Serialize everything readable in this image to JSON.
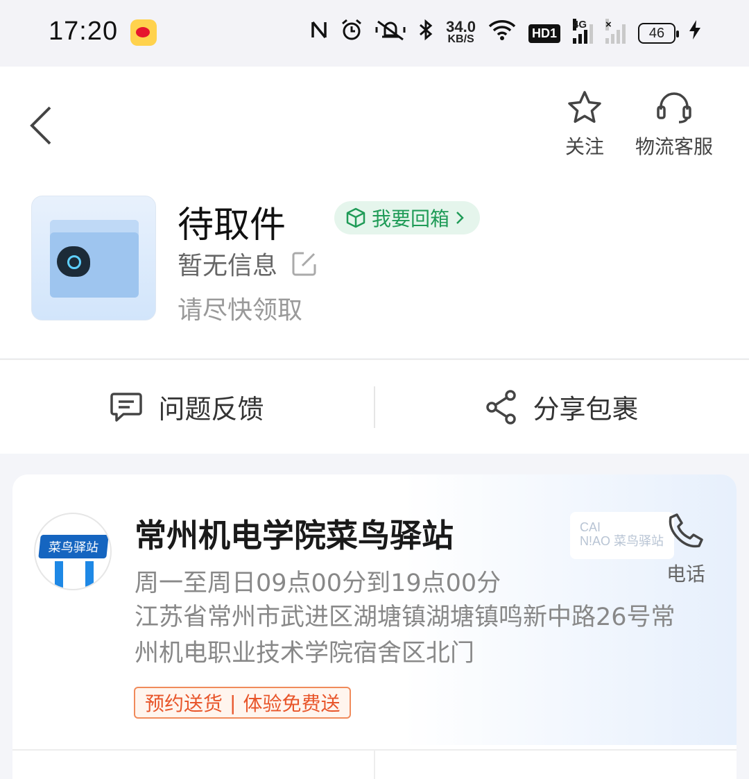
{
  "status_bar": {
    "time": "17:20",
    "net_speed_value": "34.0",
    "net_speed_unit": "KB/S",
    "hd_label": "HD1",
    "signal_label": "4G",
    "signal2_label": "×",
    "battery_level": "46",
    "icons": [
      "weibo-icon",
      "nfc-icon",
      "alarm-icon",
      "mute-icon",
      "bluetooth-icon",
      "wifi-icon",
      "charging-icon"
    ]
  },
  "header": {
    "follow_label": "关注",
    "service_label": "物流客服"
  },
  "package": {
    "status": "待取件",
    "return_label": "我要回箱",
    "info": "暂无信息",
    "hint": "请尽快领取"
  },
  "actions": {
    "feedback_label": "问题反馈",
    "share_label": "分享包裹"
  },
  "station": {
    "logo_text": "菜鸟驿站",
    "name": "常州机电学院菜鸟驿站",
    "hours": "周一至周日09点00分到19点00分",
    "address": "江苏省常州市武进区湖塘镇湖塘镇鸣新中路26号常州机电职业技术学院宿舍区北门",
    "promo_left": "预约送货",
    "promo_sep": "|",
    "promo_right": "体验免费送",
    "badge_line1": "CAI",
    "badge_line2": "N!AO 菜鸟驿站",
    "phone_label": "电话"
  },
  "colors": {
    "accent_green": "#1f9b57",
    "promo_orange": "#e8552a",
    "station_blue": "#1565c0"
  }
}
